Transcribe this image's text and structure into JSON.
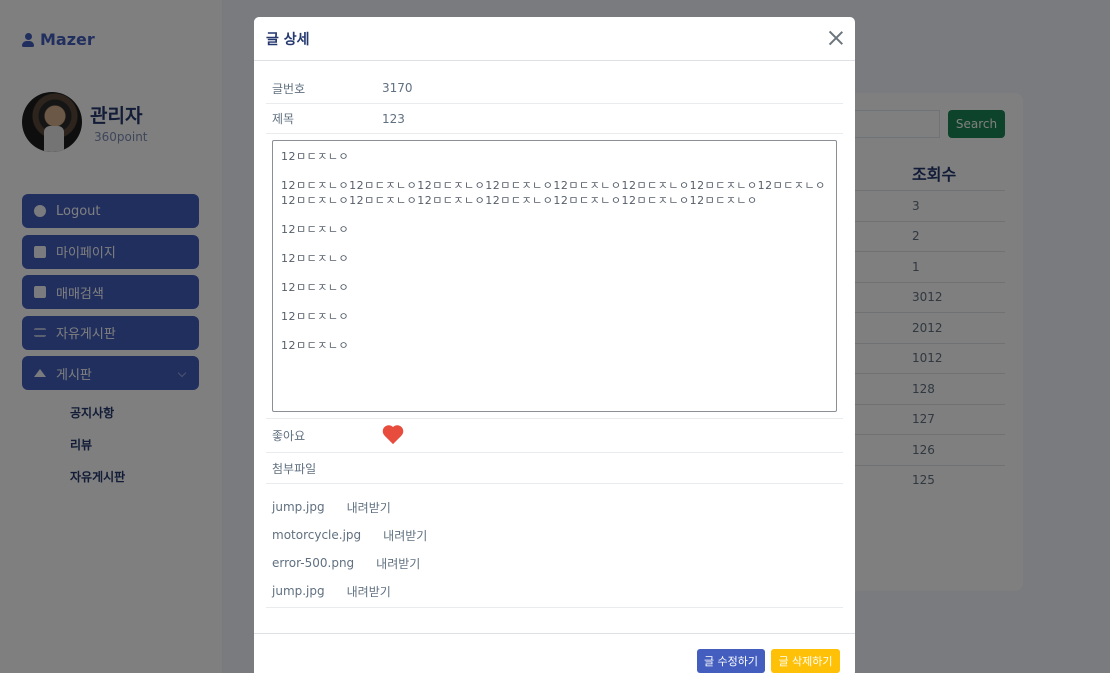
{
  "sidebar": {
    "brand": "Mazer",
    "profile": {
      "name": "관리자",
      "points": "360point"
    },
    "menu": [
      {
        "label": "Logout"
      },
      {
        "label": "마이페이지"
      },
      {
        "label": "매매검색"
      },
      {
        "label": "자유게시판"
      },
      {
        "label": "게시판"
      }
    ],
    "submenu": [
      "공지사항",
      "리뷰",
      "자유게시판"
    ]
  },
  "page": {
    "search_button": "Search",
    "views_header": "조회수",
    "views": [
      "3",
      "2",
      "1",
      "3012",
      "2012",
      "1012",
      "128",
      "127",
      "126",
      "125"
    ]
  },
  "modal": {
    "title": "글 상세",
    "post_number_label": "글번호",
    "post_number": "3170",
    "title_label": "제목",
    "post_title": "123",
    "content_lines": [
      "12ㅁㄷㅈㄴㅇ",
      "12ㅁㄷㅈㄴㅇ12ㅁㄷㅈㄴㅇ12ㅁㄷㅈㄴㅇ12ㅁㄷㅈㄴㅇ12ㅁㄷㅈㄴㅇ12ㅁㄷㅈㄴㅇ12ㅁㄷㅈㄴㅇ12ㅁㄷㅈㄴㅇ12ㅁㄷㅈㄴㅇ12ㅁㄷㅈㄴㅇ12ㅁㄷㅈㄴㅇ12ㅁㄷㅈㄴㅇ12ㅁㄷㅈㄴㅇ12ㅁㄷㅈㄴㅇ12ㅁㄷㅈㄴㅇ",
      "12ㅁㄷㅈㄴㅇ",
      "12ㅁㄷㅈㄴㅇ",
      "12ㅁㄷㅈㄴㅇ",
      "12ㅁㄷㅈㄴㅇ",
      "12ㅁㄷㅈㄴㅇ"
    ],
    "like_label": "좋아요",
    "like_icon": "heart-icon",
    "like_color": "#e74c3c",
    "attachments_label": "첨부파일",
    "files": [
      {
        "name": "jump.jpg",
        "download": "내려받기"
      },
      {
        "name": "motorcycle.jpg",
        "download": "내려받기"
      },
      {
        "name": "error-500.png",
        "download": "내려받기"
      },
      {
        "name": "jump.jpg",
        "download": "내려받기"
      }
    ],
    "edit_button": "글 수정하기",
    "delete_button": "글 삭제하기"
  },
  "colors": {
    "primary": "#435ebe",
    "search": "#198754",
    "warning": "#ffc107"
  }
}
